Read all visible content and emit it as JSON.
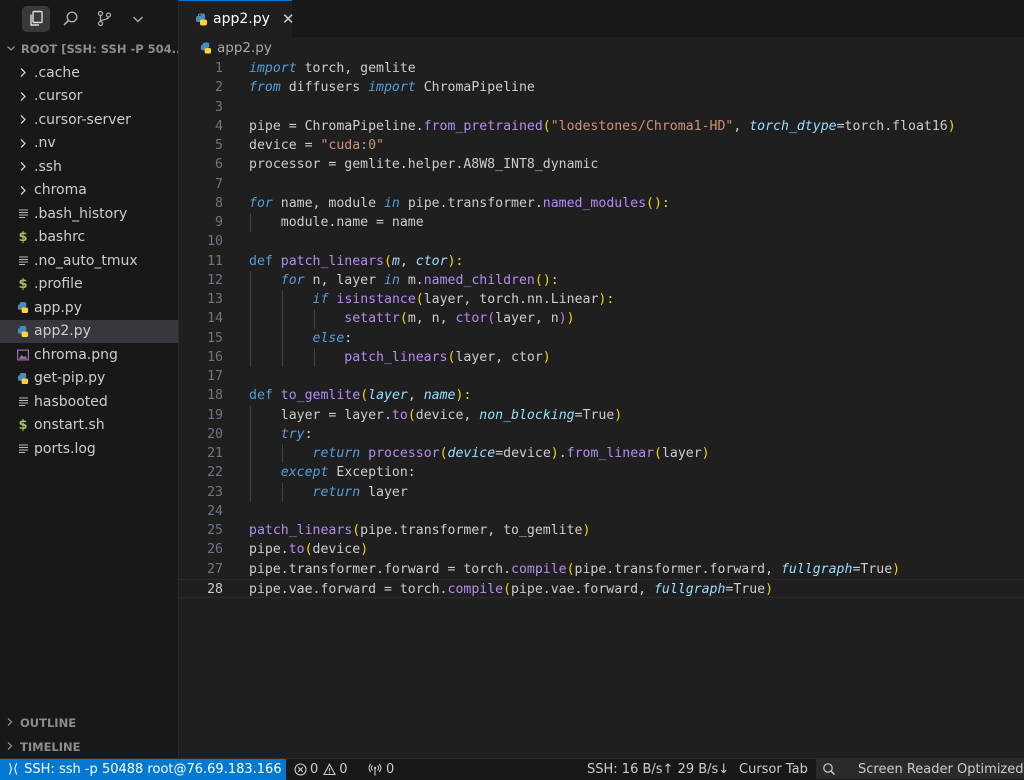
{
  "sidebar": {
    "explorer_title": "ROOT [SSH: SSH -P 504...",
    "items": [
      {
        "label": ".cache",
        "icon": "chevron-right-icon"
      },
      {
        "label": ".cursor",
        "icon": "chevron-right-icon"
      },
      {
        "label": ".cursor-server",
        "icon": "chevron-right-icon"
      },
      {
        "label": ".nv",
        "icon": "chevron-right-icon"
      },
      {
        "label": ".ssh",
        "icon": "chevron-right-icon"
      },
      {
        "label": "chroma",
        "icon": "chevron-right-icon"
      },
      {
        "label": ".bash_history",
        "icon": "text-file-icon"
      },
      {
        "label": ".bashrc",
        "icon": "dollar-shell-icon"
      },
      {
        "label": ".no_auto_tmux",
        "icon": "text-file-icon"
      },
      {
        "label": ".profile",
        "icon": "dollar-shell-icon"
      },
      {
        "label": "app.py",
        "icon": "python-icon"
      },
      {
        "label": "app2.py",
        "icon": "python-icon"
      },
      {
        "label": "chroma.png",
        "icon": "image-file-icon"
      },
      {
        "label": "get-pip.py",
        "icon": "python-icon"
      },
      {
        "label": "hasbooted",
        "icon": "text-file-icon"
      },
      {
        "label": "onstart.sh",
        "icon": "dollar-shell-icon"
      },
      {
        "label": "ports.log",
        "icon": "text-file-icon"
      }
    ],
    "selected_index": 11,
    "outline_label": "OUTLINE",
    "timeline_label": "TIMELINE"
  },
  "tab": {
    "label": "app2.py"
  },
  "breadcrumb": {
    "label": "app2.py"
  },
  "editor": {
    "current_line": 28,
    "lines": [
      [
        [
          "import",
          "k"
        ],
        [
          " torch, gemlite",
          ""
        ]
      ],
      [
        [
          "from",
          "k"
        ],
        [
          " diffusers ",
          ""
        ],
        [
          "import",
          "k"
        ],
        [
          " ChromaPipeline",
          ""
        ]
      ],
      [],
      [
        [
          "pipe = ChromaPipeline.",
          ""
        ],
        [
          "from_pretrained",
          "f"
        ],
        [
          "(",
          "br"
        ],
        [
          "\"lodestones/Chroma1-HD\"",
          "s"
        ],
        [
          ", ",
          ""
        ],
        [
          "torch_dtype",
          "p"
        ],
        [
          "=torch.float16",
          ""
        ],
        [
          ")",
          "br"
        ]
      ],
      [
        [
          "device = ",
          ""
        ],
        [
          "\"cuda:0\"",
          "s"
        ]
      ],
      [
        [
          "processor = gemlite.helper.A8W8_INT8_dynamic",
          ""
        ]
      ],
      [],
      [
        [
          "for",
          "k"
        ],
        [
          " name, module ",
          ""
        ],
        [
          "in",
          "k"
        ],
        [
          " pipe.transformer.",
          ""
        ],
        [
          "named_modules",
          "f"
        ],
        [
          "():",
          "br"
        ]
      ],
      [
        [
          "    module.name = name",
          ""
        ]
      ],
      [],
      [
        [
          "def",
          "kn"
        ],
        [
          " ",
          ""
        ],
        [
          "patch_linears",
          "f"
        ],
        [
          "(",
          "br"
        ],
        [
          "m",
          "p"
        ],
        [
          ", ",
          ""
        ],
        [
          "ctor",
          "p"
        ],
        [
          "):",
          "br"
        ]
      ],
      [
        [
          "    ",
          ""
        ],
        [
          "for",
          "k"
        ],
        [
          " n, layer ",
          ""
        ],
        [
          "in",
          "k"
        ],
        [
          " m.",
          ""
        ],
        [
          "named_children",
          "f"
        ],
        [
          "():",
          "br"
        ]
      ],
      [
        [
          "        ",
          ""
        ],
        [
          "if",
          "k"
        ],
        [
          " ",
          ""
        ],
        [
          "isinstance",
          "f"
        ],
        [
          "(",
          "br"
        ],
        [
          "layer, torch.nn.Linear",
          ""
        ],
        [
          "):",
          "br"
        ]
      ],
      [
        [
          "            ",
          ""
        ],
        [
          "setattr",
          "f"
        ],
        [
          "(",
          "br"
        ],
        [
          "m, n, ",
          ""
        ],
        [
          "ctor",
          "f"
        ],
        [
          "(",
          "brp"
        ],
        [
          "layer, n",
          ""
        ],
        [
          ")",
          "brp"
        ],
        [
          ")",
          "br"
        ]
      ],
      [
        [
          "        ",
          ""
        ],
        [
          "else",
          "k"
        ],
        [
          ":",
          ""
        ]
      ],
      [
        [
          "            ",
          ""
        ],
        [
          "patch_linears",
          "f"
        ],
        [
          "(",
          "br"
        ],
        [
          "layer, ctor",
          ""
        ],
        [
          ")",
          "br"
        ]
      ],
      [],
      [
        [
          "def",
          "kn"
        ],
        [
          " ",
          ""
        ],
        [
          "to_gemlite",
          "f"
        ],
        [
          "(",
          "br"
        ],
        [
          "layer",
          "p"
        ],
        [
          ", ",
          ""
        ],
        [
          "name",
          "p"
        ],
        [
          "):",
          "br"
        ]
      ],
      [
        [
          "    layer = layer.",
          ""
        ],
        [
          "to",
          "f"
        ],
        [
          "(",
          "br"
        ],
        [
          "device, ",
          ""
        ],
        [
          "non_blocking",
          "p"
        ],
        [
          "=True",
          ""
        ],
        [
          ")",
          "br"
        ]
      ],
      [
        [
          "    ",
          ""
        ],
        [
          "try",
          "k"
        ],
        [
          ":",
          ""
        ]
      ],
      [
        [
          "        ",
          ""
        ],
        [
          "return",
          "k"
        ],
        [
          " ",
          ""
        ],
        [
          "processor",
          "f"
        ],
        [
          "(",
          "br"
        ],
        [
          "device",
          "p"
        ],
        [
          "=device",
          ""
        ],
        [
          ")",
          "br"
        ],
        [
          ".",
          ""
        ],
        [
          "from_linear",
          "f"
        ],
        [
          "(",
          "br"
        ],
        [
          "layer",
          ""
        ],
        [
          ")",
          "br"
        ]
      ],
      [
        [
          "    ",
          ""
        ],
        [
          "except",
          "k"
        ],
        [
          " Exception:",
          ""
        ]
      ],
      [
        [
          "        ",
          ""
        ],
        [
          "return",
          "k"
        ],
        [
          " layer",
          ""
        ]
      ],
      [],
      [
        [
          "patch_linears",
          "f"
        ],
        [
          "(",
          "br"
        ],
        [
          "pipe.transformer, to_gemlite",
          ""
        ],
        [
          ")",
          "br"
        ]
      ],
      [
        [
          "pipe.",
          ""
        ],
        [
          "to",
          "f"
        ],
        [
          "(",
          "br"
        ],
        [
          "device",
          ""
        ],
        [
          ")",
          "br"
        ]
      ],
      [
        [
          "pipe.transformer.forward = torch.",
          ""
        ],
        [
          "compile",
          "f"
        ],
        [
          "(",
          "br"
        ],
        [
          "pipe.transformer.forward, ",
          ""
        ],
        [
          "fullgraph",
          "p"
        ],
        [
          "=True",
          ""
        ],
        [
          ")",
          "br"
        ]
      ],
      [
        [
          "pipe.vae.forward = torch.",
          ""
        ],
        [
          "compile",
          "f"
        ],
        [
          "(",
          "br"
        ],
        [
          "pipe.vae.forward, ",
          ""
        ],
        [
          "fullgraph",
          "p"
        ],
        [
          "=True",
          ""
        ],
        [
          ")",
          "br"
        ]
      ]
    ]
  },
  "status": {
    "remote": "SSH: ssh -p 50488 root@76.69.183.166",
    "errors": "0",
    "warnings": "0",
    "ports": "0",
    "network": "SSH: 16 B/s↑ 29 B/s↓",
    "cursor_tab": "Cursor Tab",
    "screen_reader": "Screen Reader Optimized"
  },
  "colors": {
    "accent": "#0078d4",
    "background": "#1f1f1f",
    "sidebar": "#181818"
  }
}
